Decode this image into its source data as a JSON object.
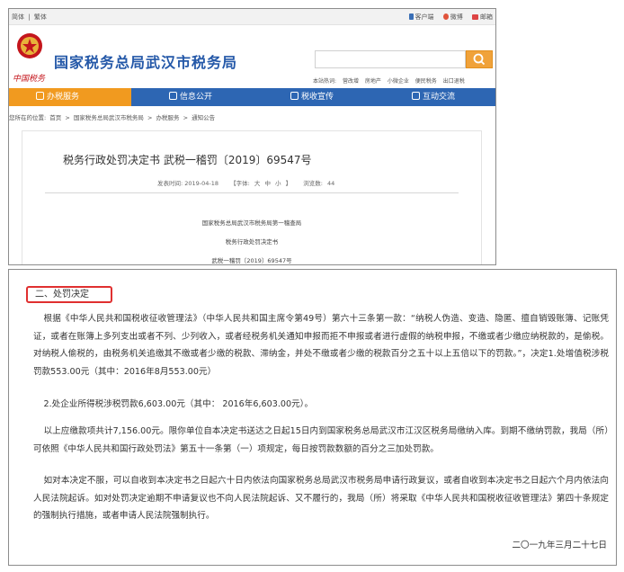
{
  "topbar": {
    "lang_simplified": "简体",
    "lang_separator": "|",
    "lang_traditional": "繁体",
    "client_label": "客户端",
    "weibo_label": "微博",
    "mail_label": "邮箱"
  },
  "header": {
    "emblem_caption": "中国税务",
    "site_title": "国家税务总局武汉市税务局",
    "hot_label": "本站热词:",
    "hot_words": [
      "营改增",
      "房地产",
      "小微企业",
      "便民税务",
      "出口退税"
    ]
  },
  "nav": {
    "items": [
      {
        "label": "办税服务",
        "active": true
      },
      {
        "label": "信息公开",
        "active": false
      },
      {
        "label": "税收宣传",
        "active": false
      },
      {
        "label": "互动交流",
        "active": false
      }
    ]
  },
  "breadcrumb": {
    "prefix": "您所在的位置:",
    "items": [
      "首页",
      "国家税务总局武汉市税务局",
      "办税服务",
      "通知公告"
    ],
    "separator": ">"
  },
  "doc": {
    "title": "税务行政处罚决定书 武税一稽罚〔2019〕69547号",
    "publish_label": "发表时间: 2019-04-18",
    "font_label": "【字体:",
    "font_big": "大",
    "font_mid": "中",
    "font_small": "小",
    "font_close": "】",
    "views_label": "浏览数:",
    "views_value": "44",
    "line1": "国家税务总局武汉市税务局第一稽查局",
    "line2": "税务行政处罚决定书",
    "line3": "武税一稽罚〔2019〕69547号"
  },
  "content": {
    "heading": "二、处罚决定",
    "para1": "根据《中华人民共和国税收征收管理法》（中华人民共和国主席令第49号）第六十三条第一款：“纳税人伪造、变造、隐匿、擅自销毁账簿、记账凭证，或者在账簿上多列支出或者不列、少列收入，或者经税务机关通知申报而拒不申报或者进行虚假的纳税申报，不缴或者少缴应纳税款的，是偷税。对纳税人偷税的，由税务机关追缴其不缴或者少缴的税款、滞纳金，并处不缴或者少缴的税款百分之五十以上五倍以下的罚款。”，决定1.处增值税涉税罚款553.00元（其中：2016年8月553.00元）",
    "para2": "2.处企业所得税涉税罚款6,603.00元（其中： 2016年6,603.00元）。",
    "para3": "以上应缴款项共计7,156.00元。限你单位自本决定书送达之日起15日内到国家税务总局武汉市江汉区税务局缴纳入库。到期不缴纳罚款，我局（所）可依照《中华人民共和国行政处罚法》第五十一条第（一）项规定，每日按罚款数额的百分之三加处罚款。",
    "para4": "如对本决定不服，可以自收到本决定书之日起六十日内依法向国家税务总局武汉市税务局申请行政复议，或者自收到本决定书之日起六个月内依法向人民法院起诉。如对处罚决定逾期不申请复议也不向人民法院起诉、又不履行的，我局（所）将采取《中华人民共和国税收征收管理法》第四十条规定的强制执行措施，或者申请人民法院强制执行。",
    "date": "二〇一九年三月二十七日"
  },
  "colors": {
    "brand_blue": "#2d66b3",
    "active_orange": "#f19a1f",
    "heading_red": "#e03030",
    "title_blue": "#2458a8"
  }
}
